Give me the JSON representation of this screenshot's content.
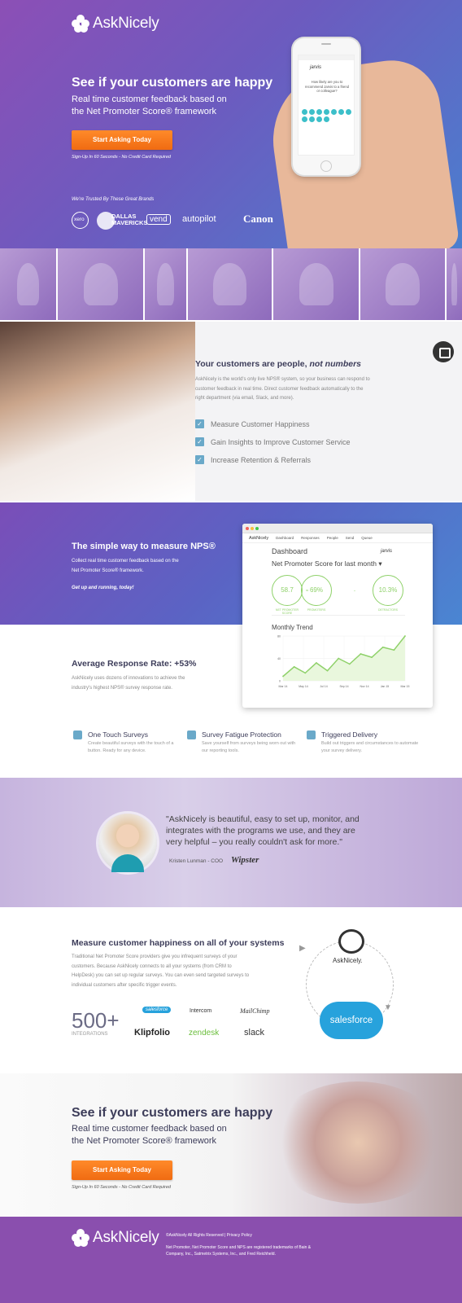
{
  "brand": {
    "name": "AskNicely"
  },
  "hero": {
    "title": "See if your customers are happy",
    "subtitle": "Real time customer feedback based on the Net Promoter Score® framework",
    "cta_label": "Start Asking Today",
    "cta_note": "Sign-Up In 60 Seconds - No Credit Card Required",
    "trusted_label": "We're Trusted By These Great Brands",
    "brands": [
      "xero",
      "DALLAS MAVERICKS",
      "vend",
      "autopilot",
      "Canon"
    ],
    "phone": {
      "app": "jarvis",
      "question": "How likely are you to recommend Jarvis to a friend or colleague?"
    }
  },
  "people": {
    "title_a": "Your customers are people, ",
    "title_b": "not numbers",
    "body": "AskNicely is the world's only live NPS® system, so your business can respond to customer feedback in real time. Direct customer feedback automatically to the right department (via email, Slack, and more).",
    "checks": [
      "Measure Customer Happiness",
      "Gain Insights to Improve Customer Service",
      "Increase Retention & Referrals"
    ]
  },
  "nps": {
    "title": "The simple way to measure NPS®",
    "body": "Collect real time customer feedback based on the Net Promoter Score® framework.",
    "tagline": "Get up and running, today!",
    "rate_title": "Average Response Rate: +53%",
    "rate_body": "AskNicely uses dozens of innovations to achieve the industry's highest NPS® survey response rate."
  },
  "dashboard": {
    "logo": "AskNicely",
    "nav": [
      "Dashboard",
      "Responses",
      "People",
      "Send",
      "Queue"
    ],
    "title": "Dashboard",
    "client": "jarvis",
    "nps_label": "Net Promoter Score for last month",
    "scores": [
      {
        "value": "58.7",
        "label": "NET PROMOTER SCORE"
      },
      {
        "value": "69%",
        "label": "PROMOTERS"
      },
      {
        "value": "10.3%",
        "label": "DETRACTORS"
      }
    ],
    "trend_title": "Monthly Trend",
    "chart_data": {
      "type": "line",
      "title": "Monthly Trend",
      "categories": [
        "Mar 14",
        "May 14",
        "Jul 14",
        "Sep 14",
        "Nov 14",
        "Jan 15",
        "Mar 15"
      ],
      "values": [
        8,
        25,
        14,
        32,
        18,
        40,
        30,
        48,
        42,
        60,
        55,
        80
      ],
      "ytick_labels": [
        "80",
        "40",
        "0"
      ],
      "ylim": [
        0,
        80
      ]
    }
  },
  "features": [
    {
      "title": "One Touch Surveys",
      "desc": "Create beautiful surveys with the touch of a button. Ready for any device."
    },
    {
      "title": "Survey Fatigue Protection",
      "desc": "Save yourself from surveys being worn out with our reporting tools."
    },
    {
      "title": "Triggered Delivery",
      "desc": "Build out triggers and circumstances to automate your survey delivery."
    }
  ],
  "testimonial": {
    "quote": "\"AskNicely is beautiful, easy to set up, monitor, and integrates with the programs we use, and they are very helpful – you really couldn't ask for more.\"",
    "author": "Kristen Lunman - COO",
    "company": "Wipster"
  },
  "systems": {
    "title": "Measure customer happiness on all of your systems",
    "body": "Traditional Net Promoter Score providers give you infrequent surveys of your customers. Because AskNicely connects to all your systems (from CRM to HelpDesk) you can set up regular surveys. You can even send targeted surveys to individual customers after specific trigger events.",
    "count": "500+",
    "count_label": "INTEGRATIONS",
    "logos": [
      "salesforce",
      "Intercom",
      "MailChimp",
      "Klipfolio",
      "zendesk",
      "slack"
    ],
    "diagram": {
      "top": "AskNicely.",
      "bottom": "salesforce"
    }
  },
  "cta2": {
    "title": "See if your customers are happy",
    "subtitle": "Real time customer feedback based on the Net Promoter Score® framework",
    "cta_label": "Start Asking Today",
    "cta_note": "Sign-Up In 60 Seconds - No Credit Card Required"
  },
  "footer": {
    "copyright": "©AskNicely All Rights Reserved | Privacy Policy",
    "legal": "Net Promoter, Net Promoter Score and NPS are registered trademarks of Bain & Company, Inc., Satmetrix Systems, Inc., and Fred Reichheld."
  },
  "colors": {
    "accent": "#f57c1f",
    "purple": "#8a4fae",
    "blue": "#4a86d2",
    "green": "#8fd16a"
  }
}
